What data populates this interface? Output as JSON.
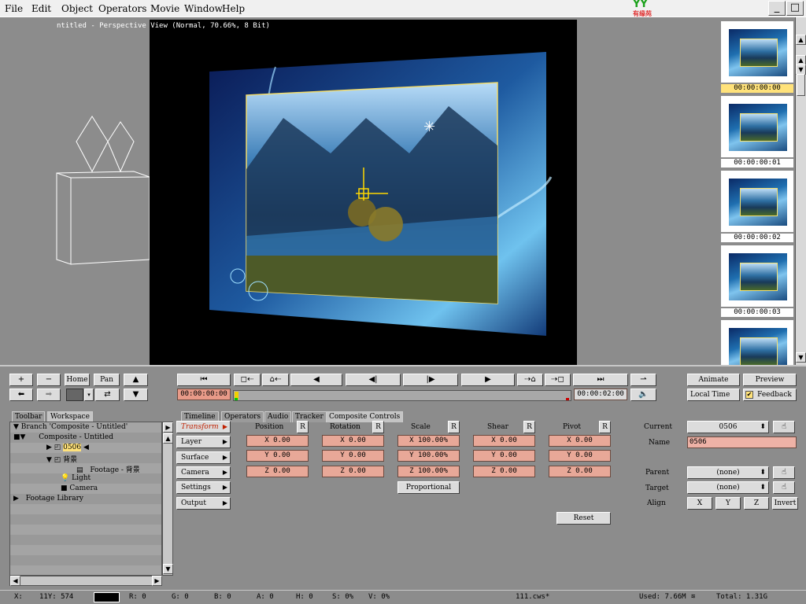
{
  "menu": {
    "items": [
      "File",
      "Edit",
      "Object",
      "Operators",
      "Movie",
      "Window",
      "Help"
    ]
  },
  "logo": {
    "text": "YY",
    "sub": "有缘苑"
  },
  "window_buttons": {
    "minimize": "_",
    "restore": "□"
  },
  "viewport": {
    "title": "ntitled - Perspective View (Normal, 70.66%, 8 Bit)"
  },
  "filmstrip": {
    "timecodes": [
      "00:00:00:00",
      "00:00:00:01",
      "00:00:00:02",
      "00:00:00:03"
    ]
  },
  "toolbar_left": {
    "plus": "+",
    "minus": "−",
    "home": "Home",
    "pan": "Pan"
  },
  "transport": {
    "start_time": "00:00:00:00",
    "end_time": "00:00:02:00"
  },
  "right_top": {
    "animate": "Animate",
    "preview": "Preview",
    "local_time": "Local Time",
    "feedback": "Feedback"
  },
  "tabs_left": [
    "Toolbar",
    "Workspace"
  ],
  "tabs_center": [
    "Timeline",
    "Operators",
    "Audio",
    "Tracker",
    "Composite Controls"
  ],
  "tree": {
    "branch": "Branch 'Composite - Untitled'",
    "composite": "Composite - Untitled",
    "layer_0506": "0506",
    "layer_bg": "背景",
    "footage": "Footage - 背景",
    "light": "Light",
    "camera": "Camera",
    "footage_library": "Footage Library"
  },
  "side_buttons": [
    "Transform",
    "Layer",
    "Surface",
    "Camera",
    "Settings",
    "Output"
  ],
  "transform": {
    "headers": [
      "Position",
      "Rotation",
      "Scale",
      "Shear",
      "Pivot"
    ],
    "reset_label": "R",
    "position": [
      "X 0.00",
      "Y 0.00",
      "Z 0.00"
    ],
    "rotation": [
      "X 0.00",
      "Y 0.00",
      "Z 0.00"
    ],
    "scale": [
      "X 100.00%",
      "Y 100.00%",
      "Z 100.00%"
    ],
    "shear": [
      "X 0.00",
      "Y 0.00",
      "Z 0.00"
    ],
    "pivot": [
      "X 0.00",
      "Y 0.00",
      "Z 0.00"
    ],
    "proportional": "Proportional",
    "reset": "Reset"
  },
  "props": {
    "current_label": "Current",
    "current_value": "0506",
    "name_label": "Name",
    "name_value": "0506",
    "parent_label": "Parent",
    "parent_value": "(none)",
    "target_label": "Target",
    "target_value": "(none)",
    "align_label": "Align",
    "align_x": "X",
    "align_y": "Y",
    "align_z": "Z",
    "invert": "Invert"
  },
  "status": {
    "x": "X:",
    "x_val": "11Y: 574",
    "r": "R: 0",
    "g": "G: 0",
    "b": "B: 0",
    "a": "A: 0",
    "h": "H: 0",
    "s": "S: 0%",
    "v": "V: 0%",
    "file": "111.cws*",
    "used": "Used: 7.66M",
    "total": "Total: 1.31G"
  }
}
